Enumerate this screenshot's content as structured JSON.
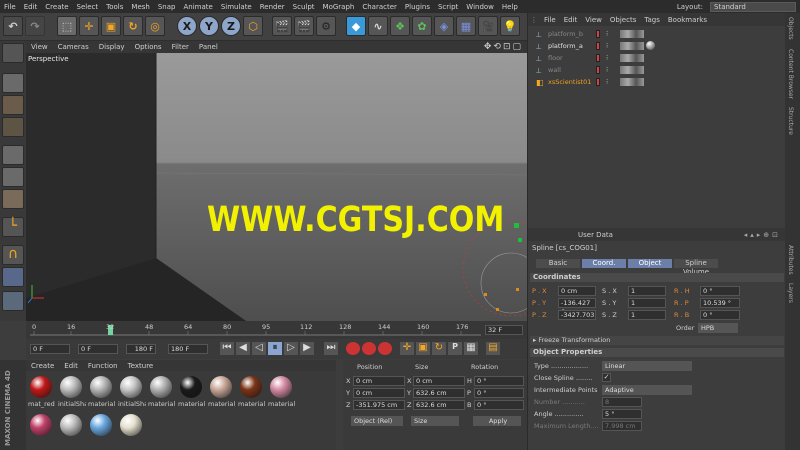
{
  "menu": [
    "File",
    "Edit",
    "Create",
    "Select",
    "Tools",
    "Mesh",
    "Snap",
    "Animate",
    "Simulate",
    "Render",
    "Sculpt",
    "MoGraph",
    "Character",
    "Plugins",
    "Script",
    "Window",
    "Help"
  ],
  "layout": {
    "label": "Layout:",
    "value": "Standard"
  },
  "toolbar": {
    "x": "X",
    "y": "Y",
    "z": "Z"
  },
  "viewport_menu": [
    "View",
    "Cameras",
    "Display",
    "Options",
    "Filter",
    "Panel"
  ],
  "viewport_label": "Perspective",
  "watermark": "WWW.CGTSJ.COM",
  "timeline": {
    "ticks": [
      "0",
      "16",
      "32",
      "48",
      "64",
      "80",
      "95",
      "112",
      "128",
      "144",
      "160",
      "176"
    ],
    "current": "32 F"
  },
  "transport": {
    "start": "0 F",
    "current": "0 F",
    "end": "180 F",
    "max": "180 F"
  },
  "materials": {
    "menu": [
      "Create",
      "Edit",
      "Function",
      "Texture"
    ],
    "items": [
      {
        "label": "mat_red",
        "color": "#c01818"
      },
      {
        "label": "initialSha",
        "color": "#bdbdbd"
      },
      {
        "label": "material",
        "color": "#b5b5b5"
      },
      {
        "label": "initialSha",
        "color": "#c6c6c6"
      },
      {
        "label": "material",
        "color": "#b2b2b2"
      },
      {
        "label": "material",
        "color": "#1a1a1a"
      },
      {
        "label": "material",
        "color": "#c9a898"
      },
      {
        "label": "material",
        "color": "#7a3317"
      },
      {
        "label": "material",
        "color": "#d48aa2"
      },
      {
        "label": "",
        "color": "#c0406a"
      },
      {
        "label": "",
        "color": "#bdbdbd"
      },
      {
        "label": "",
        "color": "#6aa7e0"
      },
      {
        "label": "",
        "color": "#e6e0cf"
      }
    ]
  },
  "coords": {
    "headers": [
      "Position",
      "Size",
      "Rotation"
    ],
    "rows": [
      {
        "a": "X",
        "p": "0 cm",
        "s": "0 cm",
        "r": "H",
        "rv": "0 °"
      },
      {
        "a": "Y",
        "p": "0 cm",
        "s": "632.6 cm",
        "r": "P",
        "rv": "0 °"
      },
      {
        "a": "Z",
        "p": "-351.975 cm",
        "s": "632.6 cm",
        "r": "B",
        "rv": "0 °"
      }
    ],
    "mode": "Object (Rel)",
    "size_mode": "Size",
    "apply": "Apply"
  },
  "objects": {
    "menu": [
      "File",
      "Edit",
      "View",
      "Objects",
      "Tags",
      "Bookmarks"
    ],
    "items": [
      {
        "name": "platform_b",
        "dim": true
      },
      {
        "name": "platform_a",
        "dim": false
      },
      {
        "name": "floor",
        "dim": true
      },
      {
        "name": "wall",
        "dim": true
      },
      {
        "name": "xsScientist01",
        "dim": false,
        "orange": true
      }
    ]
  },
  "attributes": {
    "header": "User Data",
    "object": "Spline [cs_COG01]",
    "tabs": [
      "Basic",
      "Coord.",
      "Object",
      "Spline Volume"
    ],
    "coordinates_title": "Coordinates",
    "coord_rows": [
      {
        "p": "P . X",
        "pv": "0 cm",
        "s": "S . X",
        "sv": "1",
        "r": "R . H",
        "rv": "0 °"
      },
      {
        "p": "P . Y",
        "pv": "-136.427 c",
        "s": "S . Y",
        "sv": "1",
        "r": "R . P",
        "rv": "10.539 °"
      },
      {
        "p": "P . Z",
        "pv": "-3427.703",
        "s": "S . Z",
        "sv": "1",
        "r": "R . B",
        "rv": "0 °"
      }
    ],
    "order_label": "Order",
    "order_value": "HPB",
    "freeze": "Freeze Transformation",
    "props_title": "Object Properties",
    "props": [
      {
        "label": "Type ..................",
        "value": "Linear"
      },
      {
        "label": "Close Spline ........",
        "value": "✓"
      },
      {
        "label": "Intermediate Points",
        "value": "Adaptive"
      },
      {
        "label": "Number ...........",
        "value": "8"
      },
      {
        "label": "Angle ..............",
        "value": "5 °"
      },
      {
        "label": "Maximum Length....",
        "value": "7.998 cm"
      }
    ]
  },
  "right_tabs": [
    "Objects",
    "Content Browser",
    "Structure",
    "Attributes",
    "Layers"
  ],
  "brand": "MAXON CINEMA 4D"
}
